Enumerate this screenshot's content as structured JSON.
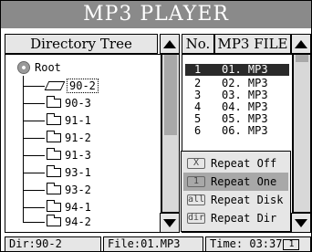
{
  "title": "MP3 PLAYER",
  "directory_header": "Directory Tree",
  "file_header": {
    "no": "No.",
    "name": "MP3 FILE"
  },
  "tree": {
    "root": "Root",
    "items": [
      {
        "label": "90-2",
        "selected": true,
        "open": true
      },
      {
        "label": "90-3"
      },
      {
        "label": "91-1"
      },
      {
        "label": "91-2"
      },
      {
        "label": "91-3"
      },
      {
        "label": "93-1"
      },
      {
        "label": "93-2"
      },
      {
        "label": "94-1"
      },
      {
        "label": "94-2"
      }
    ]
  },
  "files": [
    {
      "no": "1",
      "name": "01. MP3",
      "selected": true
    },
    {
      "no": "2",
      "name": "02. MP3"
    },
    {
      "no": "3",
      "name": "03. MP3"
    },
    {
      "no": "4",
      "name": "04. MP3"
    },
    {
      "no": "5",
      "name": "05. MP3"
    },
    {
      "no": "6",
      "name": "06. MP3"
    }
  ],
  "repeat_menu": [
    {
      "icon": "X",
      "label": "Repeat Off"
    },
    {
      "icon": "1",
      "label": "Repeat One",
      "selected": true
    },
    {
      "icon": "all",
      "label": "Repeat Disk"
    },
    {
      "icon": "dir",
      "label": "Repeat Dir"
    }
  ],
  "status": {
    "dir": "Dir:90-2",
    "file": "File:01.MP3",
    "time": "Time: 03:37",
    "repeat_icon": "1"
  },
  "colors": {
    "title_bg": "#8a8a8a",
    "highlight": "#2a2a2a",
    "menu_highlight": "#a8a8a8"
  }
}
